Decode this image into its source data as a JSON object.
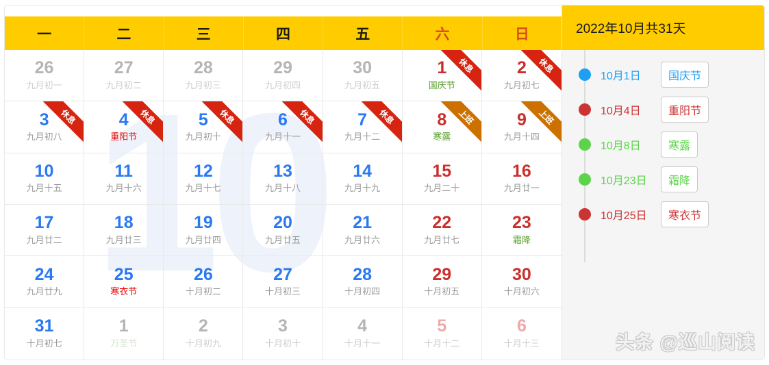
{
  "header": {
    "weekdays": [
      {
        "label": "一",
        "weekend": false
      },
      {
        "label": "二",
        "weekend": false
      },
      {
        "label": "三",
        "weekend": false
      },
      {
        "label": "四",
        "weekend": false
      },
      {
        "label": "五",
        "weekend": false
      },
      {
        "label": "六",
        "weekend": true
      },
      {
        "label": "日",
        "weekend": true
      }
    ],
    "summary": "2022年10月共31天"
  },
  "watermark_digits": [
    "1",
    "0"
  ],
  "colors": {
    "header_yellow": "#ffcc00",
    "weekday_weekend": "#d94a1e",
    "day_blue": "#2979f2",
    "day_red": "#c9302c",
    "day_grey": "#b5b5b5",
    "day_pink": "#eeaaa8",
    "ribbon_rest": "#d72410",
    "ribbon_work": "#cc7000",
    "lunar_grey": "#9a9a9a",
    "festival_red": "#ee0000",
    "solarterm_green": "#5aa02c",
    "sidebar_bg": "#f5f5f5",
    "dot_blue": "#1e9ff2",
    "dot_red": "#cc3333",
    "dot_green": "#5cd44a"
  },
  "grid": [
    [
      {
        "num": "26",
        "sub": "九月初一",
        "numClass": "n-grey",
        "subClass": "s-lgrey",
        "ribbon": ""
      },
      {
        "num": "27",
        "sub": "九月初二",
        "numClass": "n-grey",
        "subClass": "s-lgrey",
        "ribbon": ""
      },
      {
        "num": "28",
        "sub": "九月初三",
        "numClass": "n-grey",
        "subClass": "s-lgrey",
        "ribbon": ""
      },
      {
        "num": "29",
        "sub": "九月初四",
        "numClass": "n-grey",
        "subClass": "s-lgrey",
        "ribbon": ""
      },
      {
        "num": "30",
        "sub": "九月初五",
        "numClass": "n-grey",
        "subClass": "s-lgrey",
        "ribbon": ""
      },
      {
        "num": "1",
        "sub": "国庆节",
        "numClass": "n-red",
        "subClass": "s-green",
        "ribbon": "rest"
      },
      {
        "num": "2",
        "sub": "九月初七",
        "numClass": "n-red",
        "subClass": "s-grey",
        "ribbon": "rest"
      }
    ],
    [
      {
        "num": "3",
        "sub": "九月初八",
        "numClass": "n-blue",
        "subClass": "s-grey",
        "ribbon": "rest"
      },
      {
        "num": "4",
        "sub": "重阳节",
        "numClass": "n-blue",
        "subClass": "s-red",
        "ribbon": "rest"
      },
      {
        "num": "5",
        "sub": "九月初十",
        "numClass": "n-blue",
        "subClass": "s-grey",
        "ribbon": "rest"
      },
      {
        "num": "6",
        "sub": "九月十一",
        "numClass": "n-blue",
        "subClass": "s-grey",
        "ribbon": "rest"
      },
      {
        "num": "7",
        "sub": "九月十二",
        "numClass": "n-blue",
        "subClass": "s-grey",
        "ribbon": "rest"
      },
      {
        "num": "8",
        "sub": "寒露",
        "numClass": "n-red",
        "subClass": "s-green",
        "ribbon": "work"
      },
      {
        "num": "9",
        "sub": "九月十四",
        "numClass": "n-red",
        "subClass": "s-grey",
        "ribbon": "work"
      }
    ],
    [
      {
        "num": "10",
        "sub": "九月十五",
        "numClass": "n-blue",
        "subClass": "s-grey",
        "ribbon": ""
      },
      {
        "num": "11",
        "sub": "九月十六",
        "numClass": "n-blue",
        "subClass": "s-grey",
        "ribbon": ""
      },
      {
        "num": "12",
        "sub": "九月十七",
        "numClass": "n-blue",
        "subClass": "s-grey",
        "ribbon": ""
      },
      {
        "num": "13",
        "sub": "九月十八",
        "numClass": "n-blue",
        "subClass": "s-grey",
        "ribbon": ""
      },
      {
        "num": "14",
        "sub": "九月十九",
        "numClass": "n-blue",
        "subClass": "s-grey",
        "ribbon": ""
      },
      {
        "num": "15",
        "sub": "九月二十",
        "numClass": "n-red",
        "subClass": "s-grey",
        "ribbon": ""
      },
      {
        "num": "16",
        "sub": "九月廿一",
        "numClass": "n-red",
        "subClass": "s-grey",
        "ribbon": ""
      }
    ],
    [
      {
        "num": "17",
        "sub": "九月廿二",
        "numClass": "n-blue",
        "subClass": "s-grey",
        "ribbon": ""
      },
      {
        "num": "18",
        "sub": "九月廿三",
        "numClass": "n-blue",
        "subClass": "s-grey",
        "ribbon": ""
      },
      {
        "num": "19",
        "sub": "九月廿四",
        "numClass": "n-blue",
        "subClass": "s-grey",
        "ribbon": ""
      },
      {
        "num": "20",
        "sub": "九月廿五",
        "numClass": "n-blue",
        "subClass": "s-grey",
        "ribbon": ""
      },
      {
        "num": "21",
        "sub": "九月廿六",
        "numClass": "n-blue",
        "subClass": "s-grey",
        "ribbon": ""
      },
      {
        "num": "22",
        "sub": "九月廿七",
        "numClass": "n-red",
        "subClass": "s-grey",
        "ribbon": ""
      },
      {
        "num": "23",
        "sub": "霜降",
        "numClass": "n-red",
        "subClass": "s-green",
        "ribbon": ""
      }
    ],
    [
      {
        "num": "24",
        "sub": "九月廿九",
        "numClass": "n-blue",
        "subClass": "s-grey",
        "ribbon": ""
      },
      {
        "num": "25",
        "sub": "寒衣节",
        "numClass": "n-blue",
        "subClass": "s-red",
        "ribbon": ""
      },
      {
        "num": "26",
        "sub": "十月初二",
        "numClass": "n-blue",
        "subClass": "s-grey",
        "ribbon": ""
      },
      {
        "num": "27",
        "sub": "十月初三",
        "numClass": "n-blue",
        "subClass": "s-grey",
        "ribbon": ""
      },
      {
        "num": "28",
        "sub": "十月初四",
        "numClass": "n-blue",
        "subClass": "s-grey",
        "ribbon": ""
      },
      {
        "num": "29",
        "sub": "十月初五",
        "numClass": "n-red",
        "subClass": "s-grey",
        "ribbon": ""
      },
      {
        "num": "30",
        "sub": "十月初六",
        "numClass": "n-red",
        "subClass": "s-grey",
        "ribbon": ""
      }
    ],
    [
      {
        "num": "31",
        "sub": "十月初七",
        "numClass": "n-blue",
        "subClass": "s-grey",
        "ribbon": ""
      },
      {
        "num": "1",
        "sub": "万圣节",
        "numClass": "n-grey",
        "subClass": "s-lgreen",
        "ribbon": ""
      },
      {
        "num": "2",
        "sub": "十月初九",
        "numClass": "n-grey",
        "subClass": "s-lgrey",
        "ribbon": ""
      },
      {
        "num": "3",
        "sub": "十月初十",
        "numClass": "n-grey",
        "subClass": "s-lgrey",
        "ribbon": ""
      },
      {
        "num": "4",
        "sub": "十月十一",
        "numClass": "n-grey",
        "subClass": "s-lgrey",
        "ribbon": ""
      },
      {
        "num": "5",
        "sub": "十月十二",
        "numClass": "n-pink",
        "subClass": "s-lgrey",
        "ribbon": ""
      },
      {
        "num": "6",
        "sub": "十月十三",
        "numClass": "n-pink",
        "subClass": "s-lgrey",
        "ribbon": ""
      }
    ]
  ],
  "ribbon_labels": {
    "rest": "休息",
    "work": "上班"
  },
  "sidebar": {
    "title": "2022年10月共31天",
    "events": [
      {
        "date": "10月1日",
        "tag": "国庆节",
        "dot": "#1e9ff2",
        "text": "#1e9ff2"
      },
      {
        "date": "10月4日",
        "tag": "重阳节",
        "dot": "#cc3333",
        "text": "#cc3333"
      },
      {
        "date": "10月8日",
        "tag": "寒露",
        "dot": "#5cd44a",
        "text": "#5cd44a"
      },
      {
        "date": "10月23日",
        "tag": "霜降",
        "dot": "#5cd44a",
        "text": "#5cd44a"
      },
      {
        "date": "10月25日",
        "tag": "寒衣节",
        "dot": "#cc3333",
        "text": "#cc3333"
      }
    ]
  },
  "watermark": "头条 @巡山阅读"
}
